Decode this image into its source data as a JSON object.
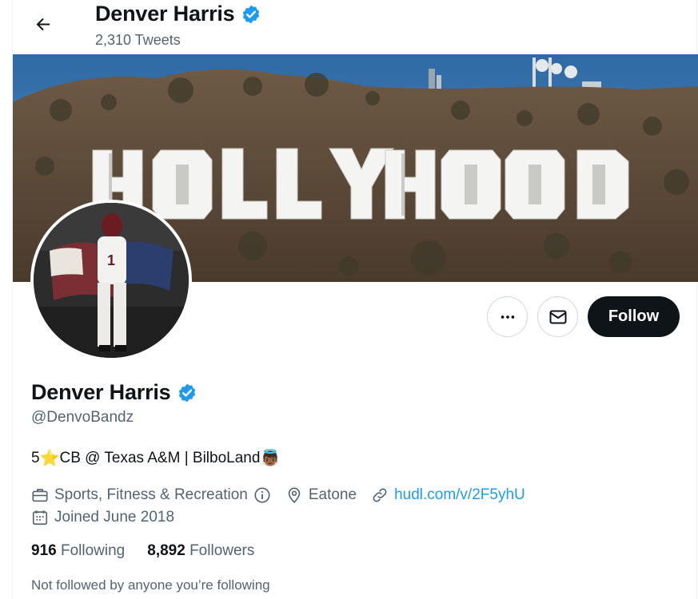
{
  "header": {
    "name": "Denver Harris",
    "tweet_count": "2,310 Tweets"
  },
  "banner": {
    "sign_text": "HOLLYWOOD"
  },
  "actions": {
    "follow_label": "Follow"
  },
  "profile": {
    "name": "Denver Harris",
    "handle": "@DenvoBandz",
    "bio_prefix": "5",
    "bio_star": "⭐",
    "bio_text": "CB @ Texas A&M | BilboLand",
    "bio_emoji": "👼🏾",
    "category": "Sports, Fitness & Recreation",
    "location": "Eatone",
    "website": "hudl.com/v/2F5yhU",
    "joined": "Joined June 2018"
  },
  "stats": {
    "following_count": "916",
    "following_label": "Following",
    "followers_count": "8,892",
    "followers_label": "Followers"
  },
  "social_context": "Not followed by anyone you’re following",
  "colors": {
    "accent": "#1d9bf0",
    "text_primary": "#0f1419",
    "text_secondary": "#536471",
    "follow_bg": "#0f1419"
  },
  "icons": [
    "back-arrow-icon",
    "verified-badge-icon",
    "more-icon",
    "envelope-icon",
    "briefcase-icon",
    "info-icon",
    "location-pin-icon",
    "link-icon",
    "calendar-icon"
  ]
}
